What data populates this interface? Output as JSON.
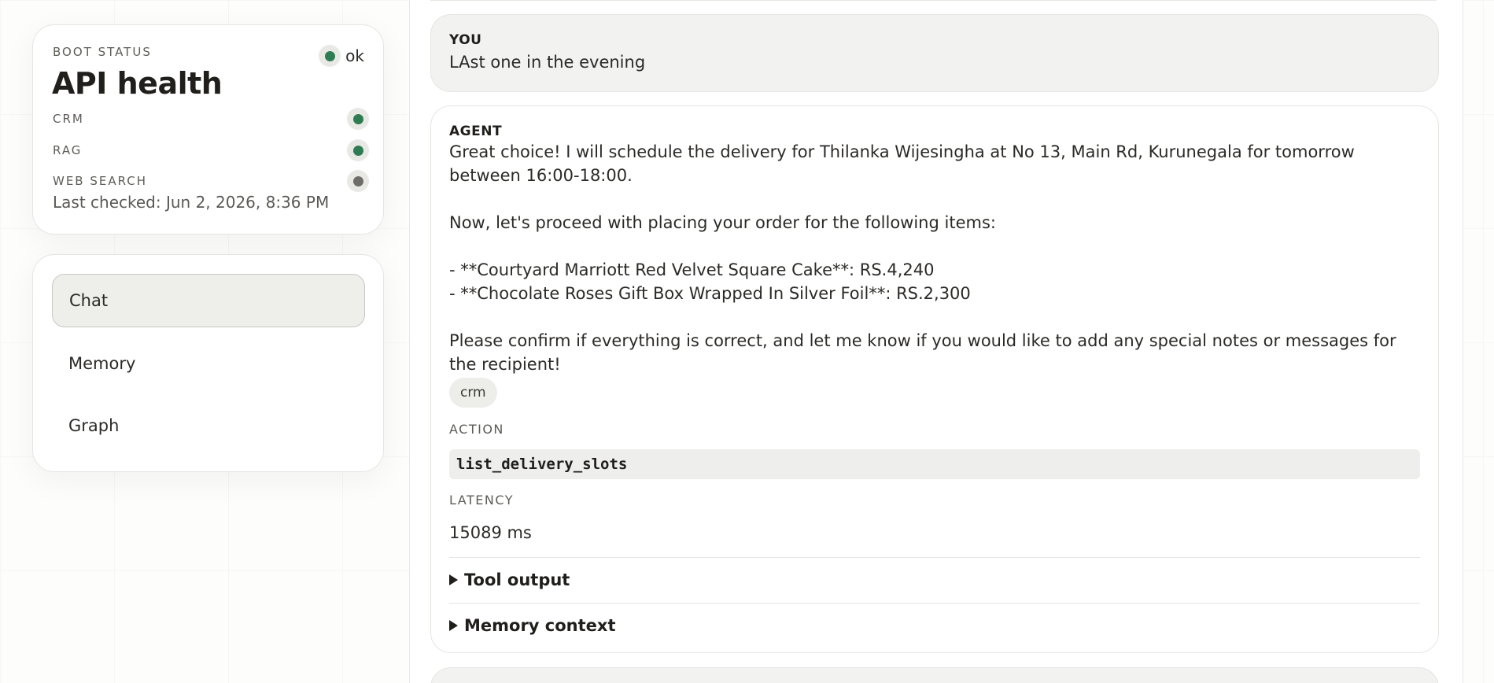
{
  "sidebar": {
    "health": {
      "kicker": "BOOT STATUS",
      "title": "API health",
      "status_text": "ok",
      "services": [
        {
          "label": "CRM",
          "state": "up",
          "color": "#2e7d52"
        },
        {
          "label": "RAG",
          "state": "up",
          "color": "#2e7d52"
        },
        {
          "label": "WEB SEARCH",
          "state": "unknown",
          "color": "#6e6d69"
        }
      ],
      "last_checked": "Last checked: Jun 2, 2026, 8:36 PM"
    },
    "nav": {
      "items": [
        {
          "label": "Chat",
          "active": true
        },
        {
          "label": "Memory",
          "active": false
        },
        {
          "label": "Graph",
          "active": false
        }
      ]
    }
  },
  "chat": {
    "user_message": {
      "role": "YOU",
      "text": "LAst one in the evening"
    },
    "agent_message": {
      "role": "AGENT",
      "paragraphs": [
        "Great choice! I will schedule the delivery for Thilanka Wijesingha at No 13, Main Rd, Kurunegala for tomorrow between 16:00-18:00.",
        "Now, let's proceed with placing your order for the following items:",
        "- **Courtyard Marriott Red Velvet Square Cake**: RS.4,240",
        "- **Chocolate Roses Gift Box Wrapped In Silver Foil**: RS.2,300",
        "Please confirm if everything is correct, and let me know if you would like to add any special notes or messages for the recipient!"
      ],
      "source_tag": "crm",
      "action_label": "ACTION",
      "action_value": "list_delivery_slots",
      "latency_label": "LATENCY",
      "latency_value": "15089 ms",
      "details": {
        "tool_output": "Tool output",
        "memory_context": "Memory context"
      }
    }
  },
  "colors": {
    "status_ok": "#2e7d52",
    "status_unknown": "#6e6d69",
    "active_nav_bg": "#eeeeeb"
  }
}
